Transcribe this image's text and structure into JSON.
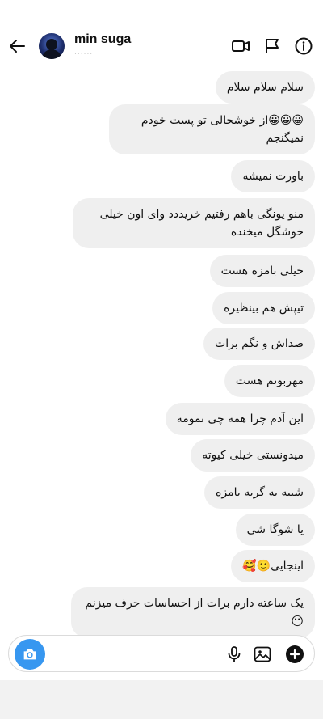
{
  "header": {
    "username": "min suga",
    "status": "·······",
    "icons": [
      "back-arrow-icon",
      "video-call-icon",
      "flag-icon",
      "info-icon"
    ]
  },
  "messages": [
    {
      "text": "سلام سلام سلام",
      "emoji": ""
    },
    {
      "text": "😀😀😀از خوشحالی تو پست خودم نمیگنجم",
      "emoji": ""
    },
    {
      "text": "باورت نمیشه",
      "emoji": ""
    },
    {
      "text": "منو یونگی باهم رفتیم خریددد وای اون خیلی خوشگل میخنده",
      "emoji": ""
    },
    {
      "text": "خیلی بامزه هست",
      "emoji": ""
    },
    {
      "text": "تیپش هم بینظیره",
      "emoji": ""
    },
    {
      "text": "صداش و نگم برات",
      "emoji": ""
    },
    {
      "text": "مهربونم هست",
      "emoji": ""
    },
    {
      "text": "این آدم چرا همه چی تمومه",
      "emoji": ""
    },
    {
      "text": "میدونستی خیلی کیوته",
      "emoji": ""
    },
    {
      "text": "شبیه یه گربه بامزه",
      "emoji": ""
    },
    {
      "text": "یا شوگا شی",
      "emoji": ""
    },
    {
      "text": "اینجایی🙂🥰",
      "emoji": ""
    },
    {
      "text": "یک ساعته دارم برات از احساسات حرف میزنم",
      "emoji": "😶"
    }
  ],
  "composer": {
    "placeholder": "",
    "icons": [
      "camera-icon",
      "microphone-icon",
      "gallery-icon",
      "add-circle-icon"
    ]
  },
  "colors": {
    "bubble": "#efefef",
    "camera_button": "#3797f0",
    "border": "#dbdbdb"
  }
}
